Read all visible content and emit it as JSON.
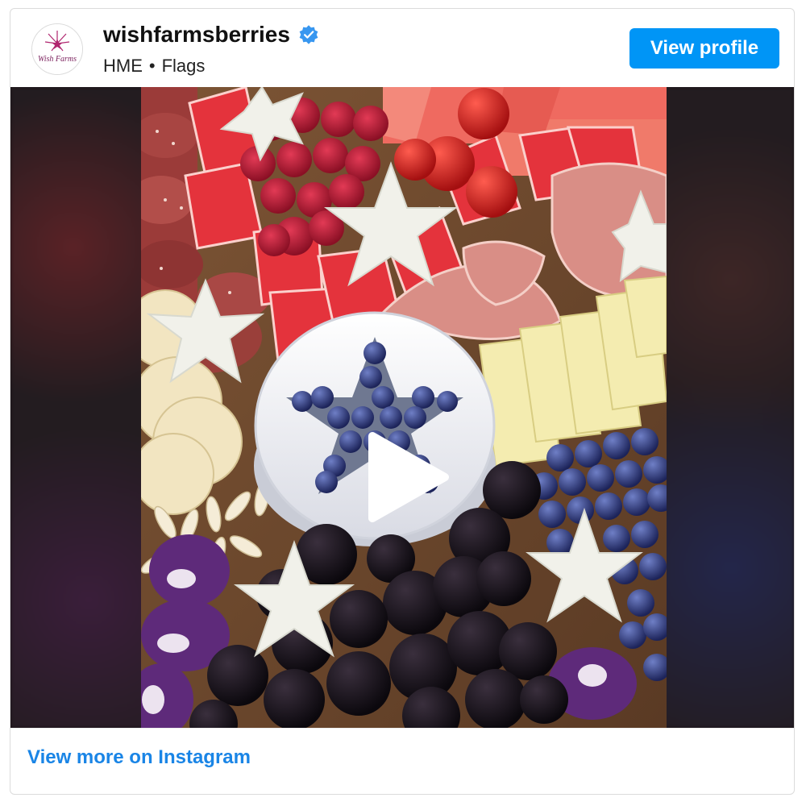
{
  "profile": {
    "username": "wishfarmsberries",
    "avatar_logo_text": "Wish Farms",
    "location": "HME",
    "separator": "•",
    "audio": "Flags",
    "verified": true,
    "view_profile_label": "View profile"
  },
  "media": {
    "type": "video",
    "play_icon": "play-icon"
  },
  "footer": {
    "view_more_label": "View more on Instagram"
  },
  "colors": {
    "accent": "#0095f6",
    "link": "#1a85e6",
    "verified": "#3897f0"
  }
}
